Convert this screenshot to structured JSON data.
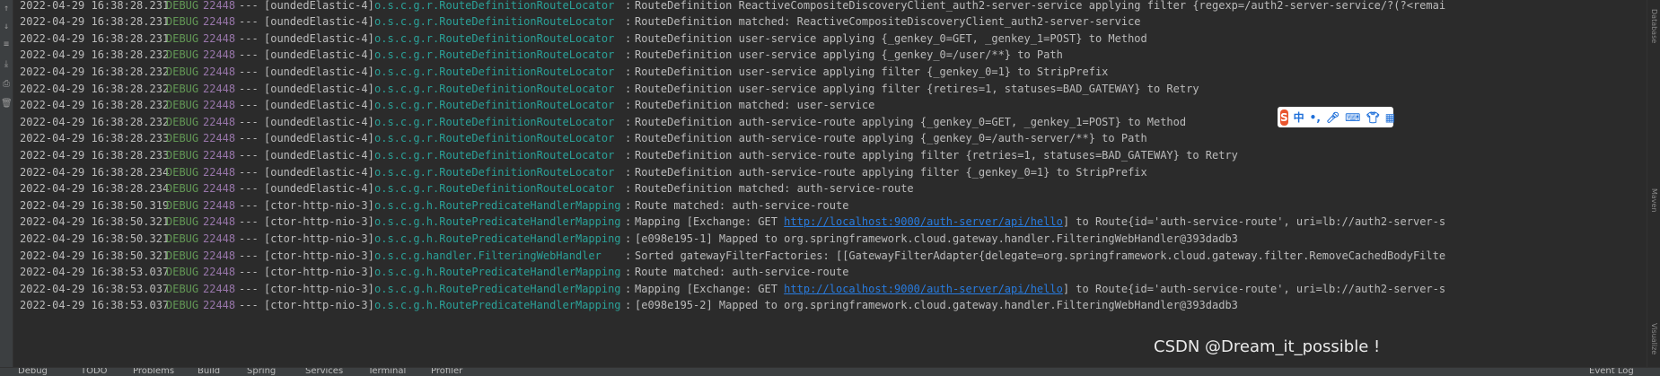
{
  "console": {
    "lines": [
      {
        "ts": "2022-04-29 16:38:28.231",
        "level": "DEBUG",
        "pid": "22448",
        "sep": "---",
        "thread": "[oundedElastic-4]",
        "logger": "o.s.c.g.r.RouteDefinitionRouteLocator",
        "msg": "RouteDefinition ReactiveCompositeDiscoveryClient_auth2-server-service applying filter {regexp=/auth2-server-service/?(?<remai",
        "link": "",
        "msg_after": ""
      },
      {
        "ts": "2022-04-29 16:38:28.231",
        "level": "DEBUG",
        "pid": "22448",
        "sep": "---",
        "thread": "[oundedElastic-4]",
        "logger": "o.s.c.g.r.RouteDefinitionRouteLocator",
        "msg": "RouteDefinition matched: ReactiveCompositeDiscoveryClient_auth2-server-service",
        "link": "",
        "msg_after": ""
      },
      {
        "ts": "2022-04-29 16:38:28.231",
        "level": "DEBUG",
        "pid": "22448",
        "sep": "---",
        "thread": "[oundedElastic-4]",
        "logger": "o.s.c.g.r.RouteDefinitionRouteLocator",
        "msg": "RouteDefinition user-service applying {_genkey_0=GET, _genkey_1=POST} to Method",
        "link": "",
        "msg_after": ""
      },
      {
        "ts": "2022-04-29 16:38:28.232",
        "level": "DEBUG",
        "pid": "22448",
        "sep": "---",
        "thread": "[oundedElastic-4]",
        "logger": "o.s.c.g.r.RouteDefinitionRouteLocator",
        "msg": "RouteDefinition user-service applying {_genkey_0=/user/**} to Path",
        "link": "",
        "msg_after": ""
      },
      {
        "ts": "2022-04-29 16:38:28.232",
        "level": "DEBUG",
        "pid": "22448",
        "sep": "---",
        "thread": "[oundedElastic-4]",
        "logger": "o.s.c.g.r.RouteDefinitionRouteLocator",
        "msg": "RouteDefinition user-service applying filter {_genkey_0=1} to StripPrefix",
        "link": "",
        "msg_after": ""
      },
      {
        "ts": "2022-04-29 16:38:28.232",
        "level": "DEBUG",
        "pid": "22448",
        "sep": "---",
        "thread": "[oundedElastic-4]",
        "logger": "o.s.c.g.r.RouteDefinitionRouteLocator",
        "msg": "RouteDefinition user-service applying filter {retires=1, statuses=BAD_GATEWAY} to Retry",
        "link": "",
        "msg_after": ""
      },
      {
        "ts": "2022-04-29 16:38:28.232",
        "level": "DEBUG",
        "pid": "22448",
        "sep": "---",
        "thread": "[oundedElastic-4]",
        "logger": "o.s.c.g.r.RouteDefinitionRouteLocator",
        "msg": "RouteDefinition matched: user-service",
        "link": "",
        "msg_after": ""
      },
      {
        "ts": "2022-04-29 16:38:28.232",
        "level": "DEBUG",
        "pid": "22448",
        "sep": "---",
        "thread": "[oundedElastic-4]",
        "logger": "o.s.c.g.r.RouteDefinitionRouteLocator",
        "msg": "RouteDefinition auth-service-route applying {_genkey_0=GET, _genkey_1=POST} to Method",
        "link": "",
        "msg_after": ""
      },
      {
        "ts": "2022-04-29 16:38:28.233",
        "level": "DEBUG",
        "pid": "22448",
        "sep": "---",
        "thread": "[oundedElastic-4]",
        "logger": "o.s.c.g.r.RouteDefinitionRouteLocator",
        "msg": "RouteDefinition auth-service-route applying {_genkey_0=/auth-server/**} to Path",
        "link": "",
        "msg_after": ""
      },
      {
        "ts": "2022-04-29 16:38:28.233",
        "level": "DEBUG",
        "pid": "22448",
        "sep": "---",
        "thread": "[oundedElastic-4]",
        "logger": "o.s.c.g.r.RouteDefinitionRouteLocator",
        "msg": "RouteDefinition auth-service-route applying filter {retries=1, statuses=BAD_GATEWAY} to Retry",
        "link": "",
        "msg_after": ""
      },
      {
        "ts": "2022-04-29 16:38:28.234",
        "level": "DEBUG",
        "pid": "22448",
        "sep": "---",
        "thread": "[oundedElastic-4]",
        "logger": "o.s.c.g.r.RouteDefinitionRouteLocator",
        "msg": "RouteDefinition auth-service-route applying filter {_genkey_0=1} to StripPrefix",
        "link": "",
        "msg_after": ""
      },
      {
        "ts": "2022-04-29 16:38:28.234",
        "level": "DEBUG",
        "pid": "22448",
        "sep": "---",
        "thread": "[oundedElastic-4]",
        "logger": "o.s.c.g.r.RouteDefinitionRouteLocator",
        "msg": "RouteDefinition matched: auth-service-route",
        "link": "",
        "msg_after": ""
      },
      {
        "ts": "2022-04-29 16:38:50.319",
        "level": "DEBUG",
        "pid": "22448",
        "sep": "---",
        "thread": "[ctor-http-nio-3]",
        "logger": "o.s.c.g.h.RoutePredicateHandlerMapping",
        "msg": "Route matched: auth-service-route",
        "link": "",
        "msg_after": ""
      },
      {
        "ts": "2022-04-29 16:38:50.321",
        "level": "DEBUG",
        "pid": "22448",
        "sep": "---",
        "thread": "[ctor-http-nio-3]",
        "logger": "o.s.c.g.h.RoutePredicateHandlerMapping",
        "msg": "Mapping [Exchange: GET ",
        "link": "http://localhost:9000/auth-server/api/hello",
        "msg_after": "] to Route{id='auth-service-route', uri=lb://auth2-server-s"
      },
      {
        "ts": "2022-04-29 16:38:50.321",
        "level": "DEBUG",
        "pid": "22448",
        "sep": "---",
        "thread": "[ctor-http-nio-3]",
        "logger": "o.s.c.g.h.RoutePredicateHandlerMapping",
        "msg": "[e098e195-1] Mapped to org.springframework.cloud.gateway.handler.FilteringWebHandler@393dadb3",
        "link": "",
        "msg_after": ""
      },
      {
        "ts": "2022-04-29 16:38:50.321",
        "level": "DEBUG",
        "pid": "22448",
        "sep": "---",
        "thread": "[ctor-http-nio-3]",
        "logger": "o.s.c.g.handler.FilteringWebHandler",
        "msg": "Sorted gatewayFilterFactories: [[GatewayFilterAdapter{delegate=org.springframework.cloud.gateway.filter.RemoveCachedBodyFilte",
        "link": "",
        "msg_after": ""
      },
      {
        "ts": "2022-04-29 16:38:53.037",
        "level": "DEBUG",
        "pid": "22448",
        "sep": "---",
        "thread": "[ctor-http-nio-3]",
        "logger": "o.s.c.g.h.RoutePredicateHandlerMapping",
        "msg": "Route matched: auth-service-route",
        "link": "",
        "msg_after": ""
      },
      {
        "ts": "2022-04-29 16:38:53.037",
        "level": "DEBUG",
        "pid": "22448",
        "sep": "---",
        "thread": "[ctor-http-nio-3]",
        "logger": "o.s.c.g.h.RoutePredicateHandlerMapping",
        "msg": "Mapping [Exchange: GET ",
        "link": "http://localhost:9000/auth-server/api/hello",
        "msg_after": "] to Route{id='auth-service-route', uri=lb://auth2-server-s"
      },
      {
        "ts": "2022-04-29 16:38:53.037",
        "level": "DEBUG",
        "pid": "22448",
        "sep": "---",
        "thread": "[ctor-http-nio-3]",
        "logger": "o.s.c.g.h.RoutePredicateHandlerMapping",
        "msg": "[e098e195-2] Mapped to org.springframework.cloud.gateway.handler.FilteringWebHandler@393dadb3",
        "link": "",
        "msg_after": ""
      }
    ]
  },
  "ime_toolbar": {
    "logo": "S",
    "lang": "中",
    "punct": "•,",
    "voice": "mic",
    "keyboard": "kbd",
    "skin": "shirt",
    "more": "grid"
  },
  "watermark": "CSDN @Dream_it_possible !",
  "right_tabs": [
    "Database",
    "Maven",
    "Visualize"
  ],
  "bottom_tabs": [
    "Debug",
    "TODO",
    "Problems",
    "Build",
    "Spring",
    "Services",
    "Terminal",
    "Profiler",
    "Event Log"
  ],
  "colors": {
    "level": "#629755",
    "pid": "#9876aa",
    "logger": "#2aa198",
    "link": "#287bde",
    "bg": "#2b2b2b"
  }
}
